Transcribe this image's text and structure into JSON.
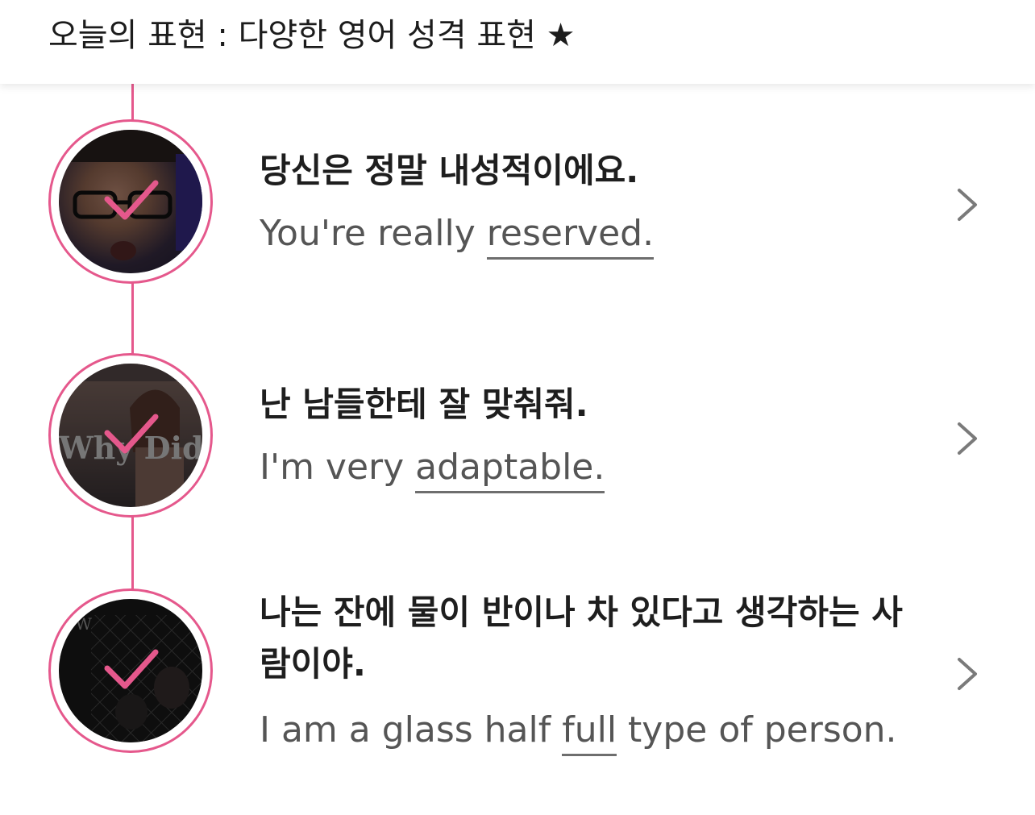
{
  "header": {
    "title": "오늘의 표현 : 다양한 영어 성격 표현 ★"
  },
  "colors": {
    "accent": "#e5588c",
    "text_primary": "#1e1e1e",
    "text_secondary": "#555555",
    "chevron": "#7a7a7a"
  },
  "items": [
    {
      "korean": "당신은 정말 내성적이에요.",
      "english_before": "You're really ",
      "english_highlight": "reserved.",
      "english_after": "",
      "thumbnail": "man-with-glasses-thumbnail",
      "status_icon": "check-icon",
      "chevron_icon": "chevron-right-icon"
    },
    {
      "korean": "난 남들한테 잘 맞춰줘.",
      "english_before": "I'm very ",
      "english_highlight": "adaptable.",
      "english_after": "",
      "thumbnail": "woman-video-thumbnail",
      "thumbnail_overlay_text": "Why Did",
      "status_icon": "check-icon",
      "chevron_icon": "chevron-right-icon"
    },
    {
      "korean": "나는 잔에 물이 반이나 차 있다고 생각하는 사람이야.",
      "english_before": "I am a glass half ",
      "english_highlight": "full",
      "english_after": " type of person.",
      "thumbnail": "dark-fence-thumbnail",
      "thumbnail_overlay_text": "OW",
      "status_icon": "check-icon",
      "chevron_icon": "chevron-right-icon"
    }
  ]
}
